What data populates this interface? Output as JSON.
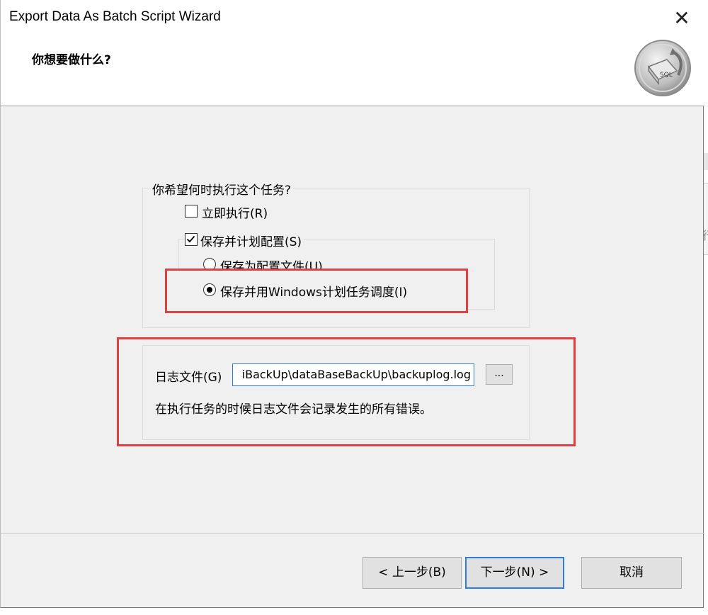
{
  "window": {
    "title": "Export Data As Batch Script Wizard",
    "close_glyph": "✕"
  },
  "header": {
    "heading": "你想要做什么?",
    "logo_text": "SQL"
  },
  "schedule_group": {
    "title": "你希望何时执行这个任务?",
    "run_now_label": "立即执行(R)",
    "run_now_checked": false,
    "save_schedule_label": "保存并计划配置(S)",
    "save_schedule_checked": true,
    "save_as_profile_label": "保存为配置文件(U)",
    "save_and_schedule_label": "保存并用Windows计划任务调度(I)",
    "selected_option": "save_and_schedule"
  },
  "log_group": {
    "log_file_label": "日志文件(G)",
    "log_file_value": "iBackUp\\dataBaseBackUp\\backuplog.log",
    "browse_label": "...",
    "description": "在执行任务的时候日志文件会记录发生的所有错误。"
  },
  "footer": {
    "back_label": "< 上一步(B)",
    "next_label": "下一步(N) >",
    "cancel_label": "取消"
  },
  "background_window": {
    "edge_text": "行"
  },
  "colors": {
    "highlight_box": "#e04040",
    "focus_blue": "#2f7bd6",
    "dialog_bg": "#f0f0f0"
  }
}
